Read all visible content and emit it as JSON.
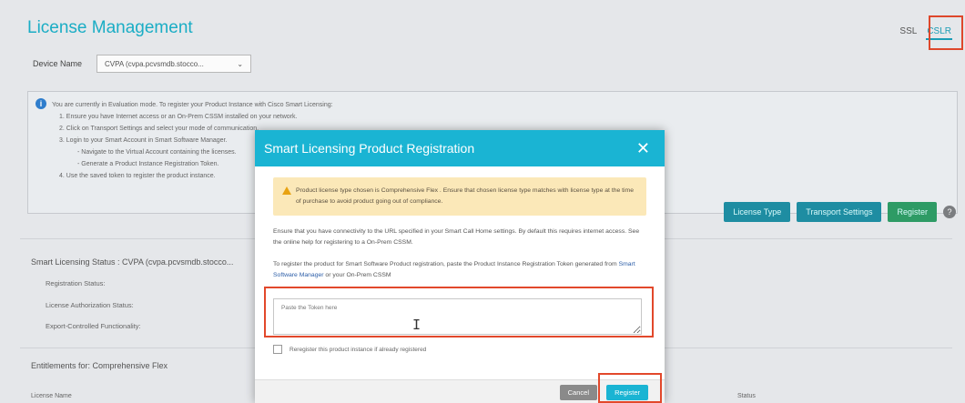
{
  "page": {
    "title": "License Management",
    "header_links": [
      "SSL",
      "CSLR"
    ]
  },
  "device": {
    "label": "Device Name",
    "selected": "CVPA (cvpa.pcvsmdb.stocco..."
  },
  "evaluation": {
    "lines": [
      "You are currently in Evaluation mode. To register your Product Instance with Cisco Smart Licensing:",
      "1. Ensure you have Internet access or an On-Prem CSSM installed on your network.",
      "2. Click on Transport Settings and select your mode of communication.",
      "3. Login to your Smart Account in Smart Software Manager.",
      "- Navigate to the Virtual Account containing the licenses.",
      "- Generate a Product Instance Registration Token.",
      "4. Use the saved token to register the product instance."
    ]
  },
  "actions": {
    "license_type": "License Type",
    "transport_settings": "Transport Settings",
    "register": "Register"
  },
  "status": {
    "heading": "Smart Licensing Status : CVPA (cvpa.pcvsmdb.stocco...",
    "rows": [
      "Registration Status:",
      "License Authorization Status:",
      "Export-Controlled Functionality:"
    ]
  },
  "entitlements": {
    "heading": "Entitlements for: Comprehensive Flex",
    "columns": [
      "License Name",
      "Status"
    ]
  },
  "modal": {
    "title": "Smart Licensing Product Registration",
    "warning": "Product license type chosen is Comprehensive Flex . Ensure that chosen license type matches with license type at the time of purchase to avoid product going out of compliance.",
    "para1": "Ensure that you have connectivity to the URL specified in your Smart Call Home settings. By default this requires internet access. See the online help for registering to a On-Prem CSSM.",
    "para2_prefix": "To register the product for Smart Software Product registration, paste the Product Instance Registration Token generated from ",
    "para2_link": "Smart Software Manager",
    "para2_suffix": " or your On-Prem CSSM",
    "token_placeholder": "Paste the Token here",
    "reregister_label": "Reregister this product instance if already registered",
    "cancel": "Cancel",
    "register": "Register"
  },
  "colors": {
    "accent": "#1ab4d3",
    "highlight": "#e2482b",
    "warning_bg": "#fbe8b8"
  }
}
